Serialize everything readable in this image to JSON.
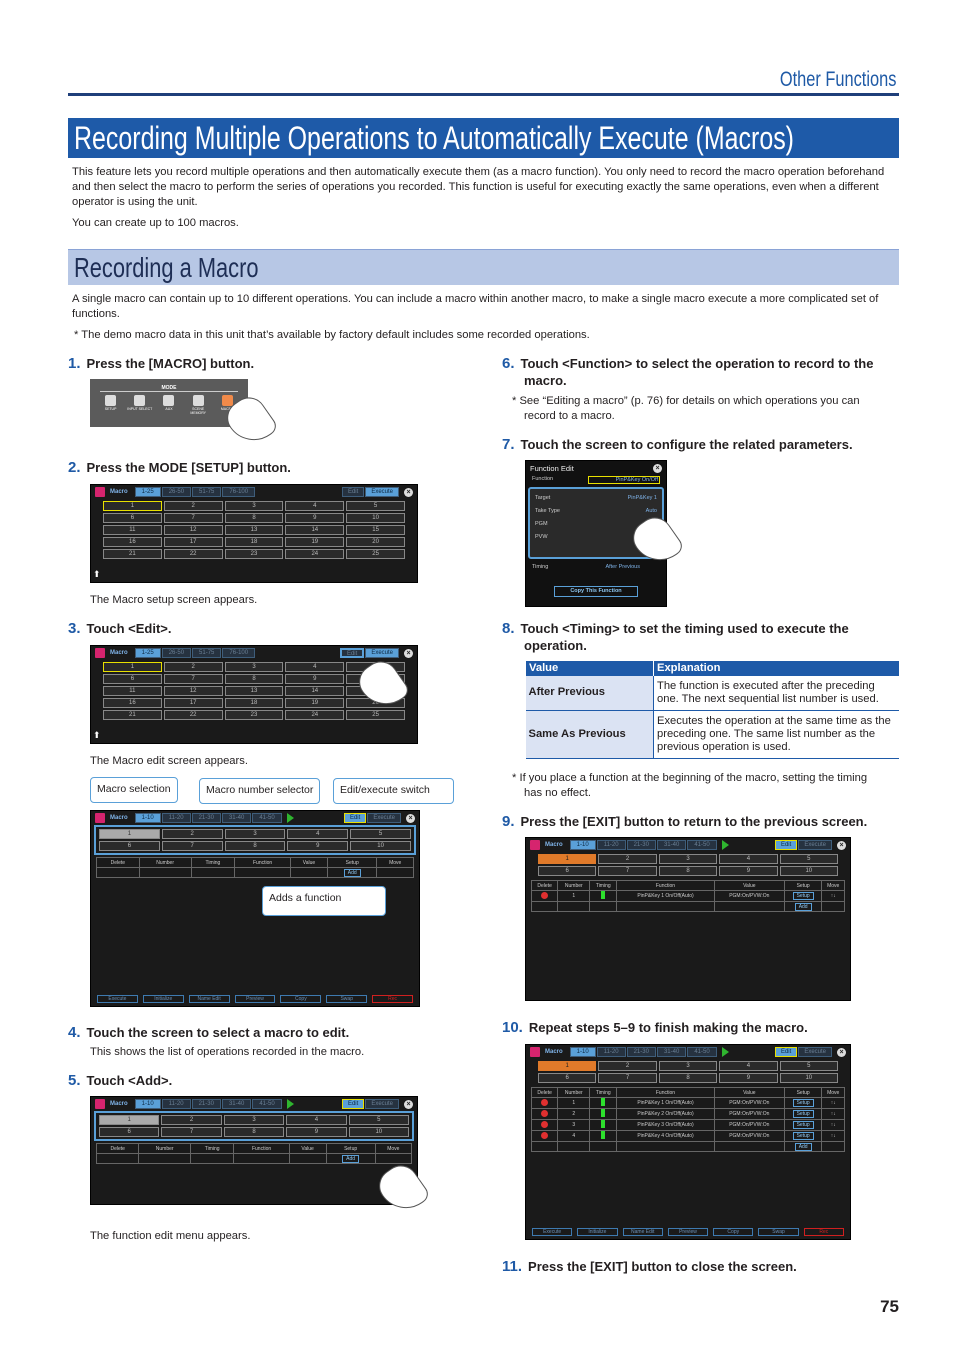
{
  "header": {
    "section": "Other Functions"
  },
  "title": "Recording Multiple Operations to Automatically Execute (Macros)",
  "intro": [
    "This feature lets you record multiple operations and then automatically execute them (as a macro function). You only need to record the macro operation beforehand and then select the macro to perform the series of operations you recorded. This function is useful for executing exactly the same operations, even when a different operator is using the unit.",
    "You can create up to 100 macros."
  ],
  "section": {
    "title": "Recording a Macro",
    "text": "A single macro can contain up to 10 different operations. You can include a macro within another macro, to make a single macro execute a more complicated set of functions.",
    "note": "*  The demo macro data in this unit that’s available by factory default includes some recorded operations."
  },
  "steps": [
    {
      "n": "1.",
      "text": "Press the [MACRO] button."
    },
    {
      "n": "2.",
      "text": "Press the MODE [SETUP] button.",
      "caption": "The Macro setup screen appears."
    },
    {
      "n": "3.",
      "text": "Touch <Edit>.",
      "caption": "The Macro edit screen appears."
    },
    {
      "n": "4.",
      "text": "Touch the screen to select a macro to edit.",
      "caption": "This shows the list of operations recorded in the macro."
    },
    {
      "n": "5.",
      "text": "Touch <Add>.",
      "caption": "The function edit menu appears."
    },
    {
      "n": "6.",
      "text": "Touch <Function> to select the operation to record to the macro.",
      "note": "*  See “Editing a macro” (p. 76) for details on which operations you can record to a macro."
    },
    {
      "n": "7.",
      "text": "Touch the screen to configure the related parameters."
    },
    {
      "n": "8.",
      "text": "Touch <Timing> to set the timing used to execute the operation."
    },
    {
      "n": "9.",
      "text": "Press the [EXIT] button to return to the previous screen."
    },
    {
      "n": "10.",
      "text": "Repeat steps 5–9 to finish making the macro."
    },
    {
      "n": "11.",
      "text": "Press the [EXIT] button to close the screen."
    }
  ],
  "timing_note": "*  If you place a function at the beginning of the macro, setting the timing has no effect.",
  "timing_table": {
    "headers": [
      "Value",
      "Explanation"
    ],
    "rows": [
      [
        "After Previous",
        "The function is executed after the preceding one. The next sequential list number is used."
      ],
      [
        "Same As Previous",
        "Executes the operation at the same time as the preceding one. The same list number as the previous operation is used."
      ]
    ]
  },
  "panel": {
    "label": "MODE",
    "buttons": [
      "SETUP",
      "INPUT SELECT",
      "AUX",
      "SCENE MEMORY",
      "MACRO"
    ]
  },
  "callouts": {
    "selection": "Macro selection",
    "number": "Macro number selector",
    "switch": "Edit/execute switch",
    "add": "Adds a function"
  },
  "screen": {
    "title": "Macro",
    "tabs25": [
      "1-25",
      "26-50",
      "51-75",
      "76-100"
    ],
    "tabs10": [
      "1-10",
      "11-20",
      "21-30",
      "31-40",
      "41-50"
    ],
    "edit": "Edit",
    "execute": "Execute",
    "cols": [
      "Delete",
      "Number",
      "Timing",
      "Function",
      "Value",
      "Setup",
      "Move"
    ],
    "add": "Add",
    "setup": "Setup",
    "move": "↑↓",
    "bottom": [
      "Execute",
      "Initialize",
      "Name Edit",
      "Preview",
      "Copy",
      "Swap",
      "Rec"
    ],
    "functions": [
      "PinP&Key 1 On/Off(Auto)",
      "PinP&Key 2 On/Off(Auto)",
      "PinP&Key 3 On/Off(Auto)",
      "PinP&Key 4 On/Off(Auto)"
    ],
    "value": "PGM:On/PVW:On"
  },
  "function_edit": {
    "title": "Function Edit",
    "function_label": "Function",
    "function_value": "PinP&Key On/Off",
    "params": [
      [
        "Target",
        "PinP&Key 1"
      ],
      [
        "Take Type",
        "Auto"
      ],
      [
        "PGM",
        "On"
      ],
      [
        "PVW",
        "On"
      ]
    ],
    "timing_label": "Timing",
    "timing_value": "After Previous",
    "copy": "Copy This Function"
  },
  "page_number": "75",
  "colors": {
    "accent": "#1e5aa8",
    "section_bg": "#b7c7e5"
  }
}
